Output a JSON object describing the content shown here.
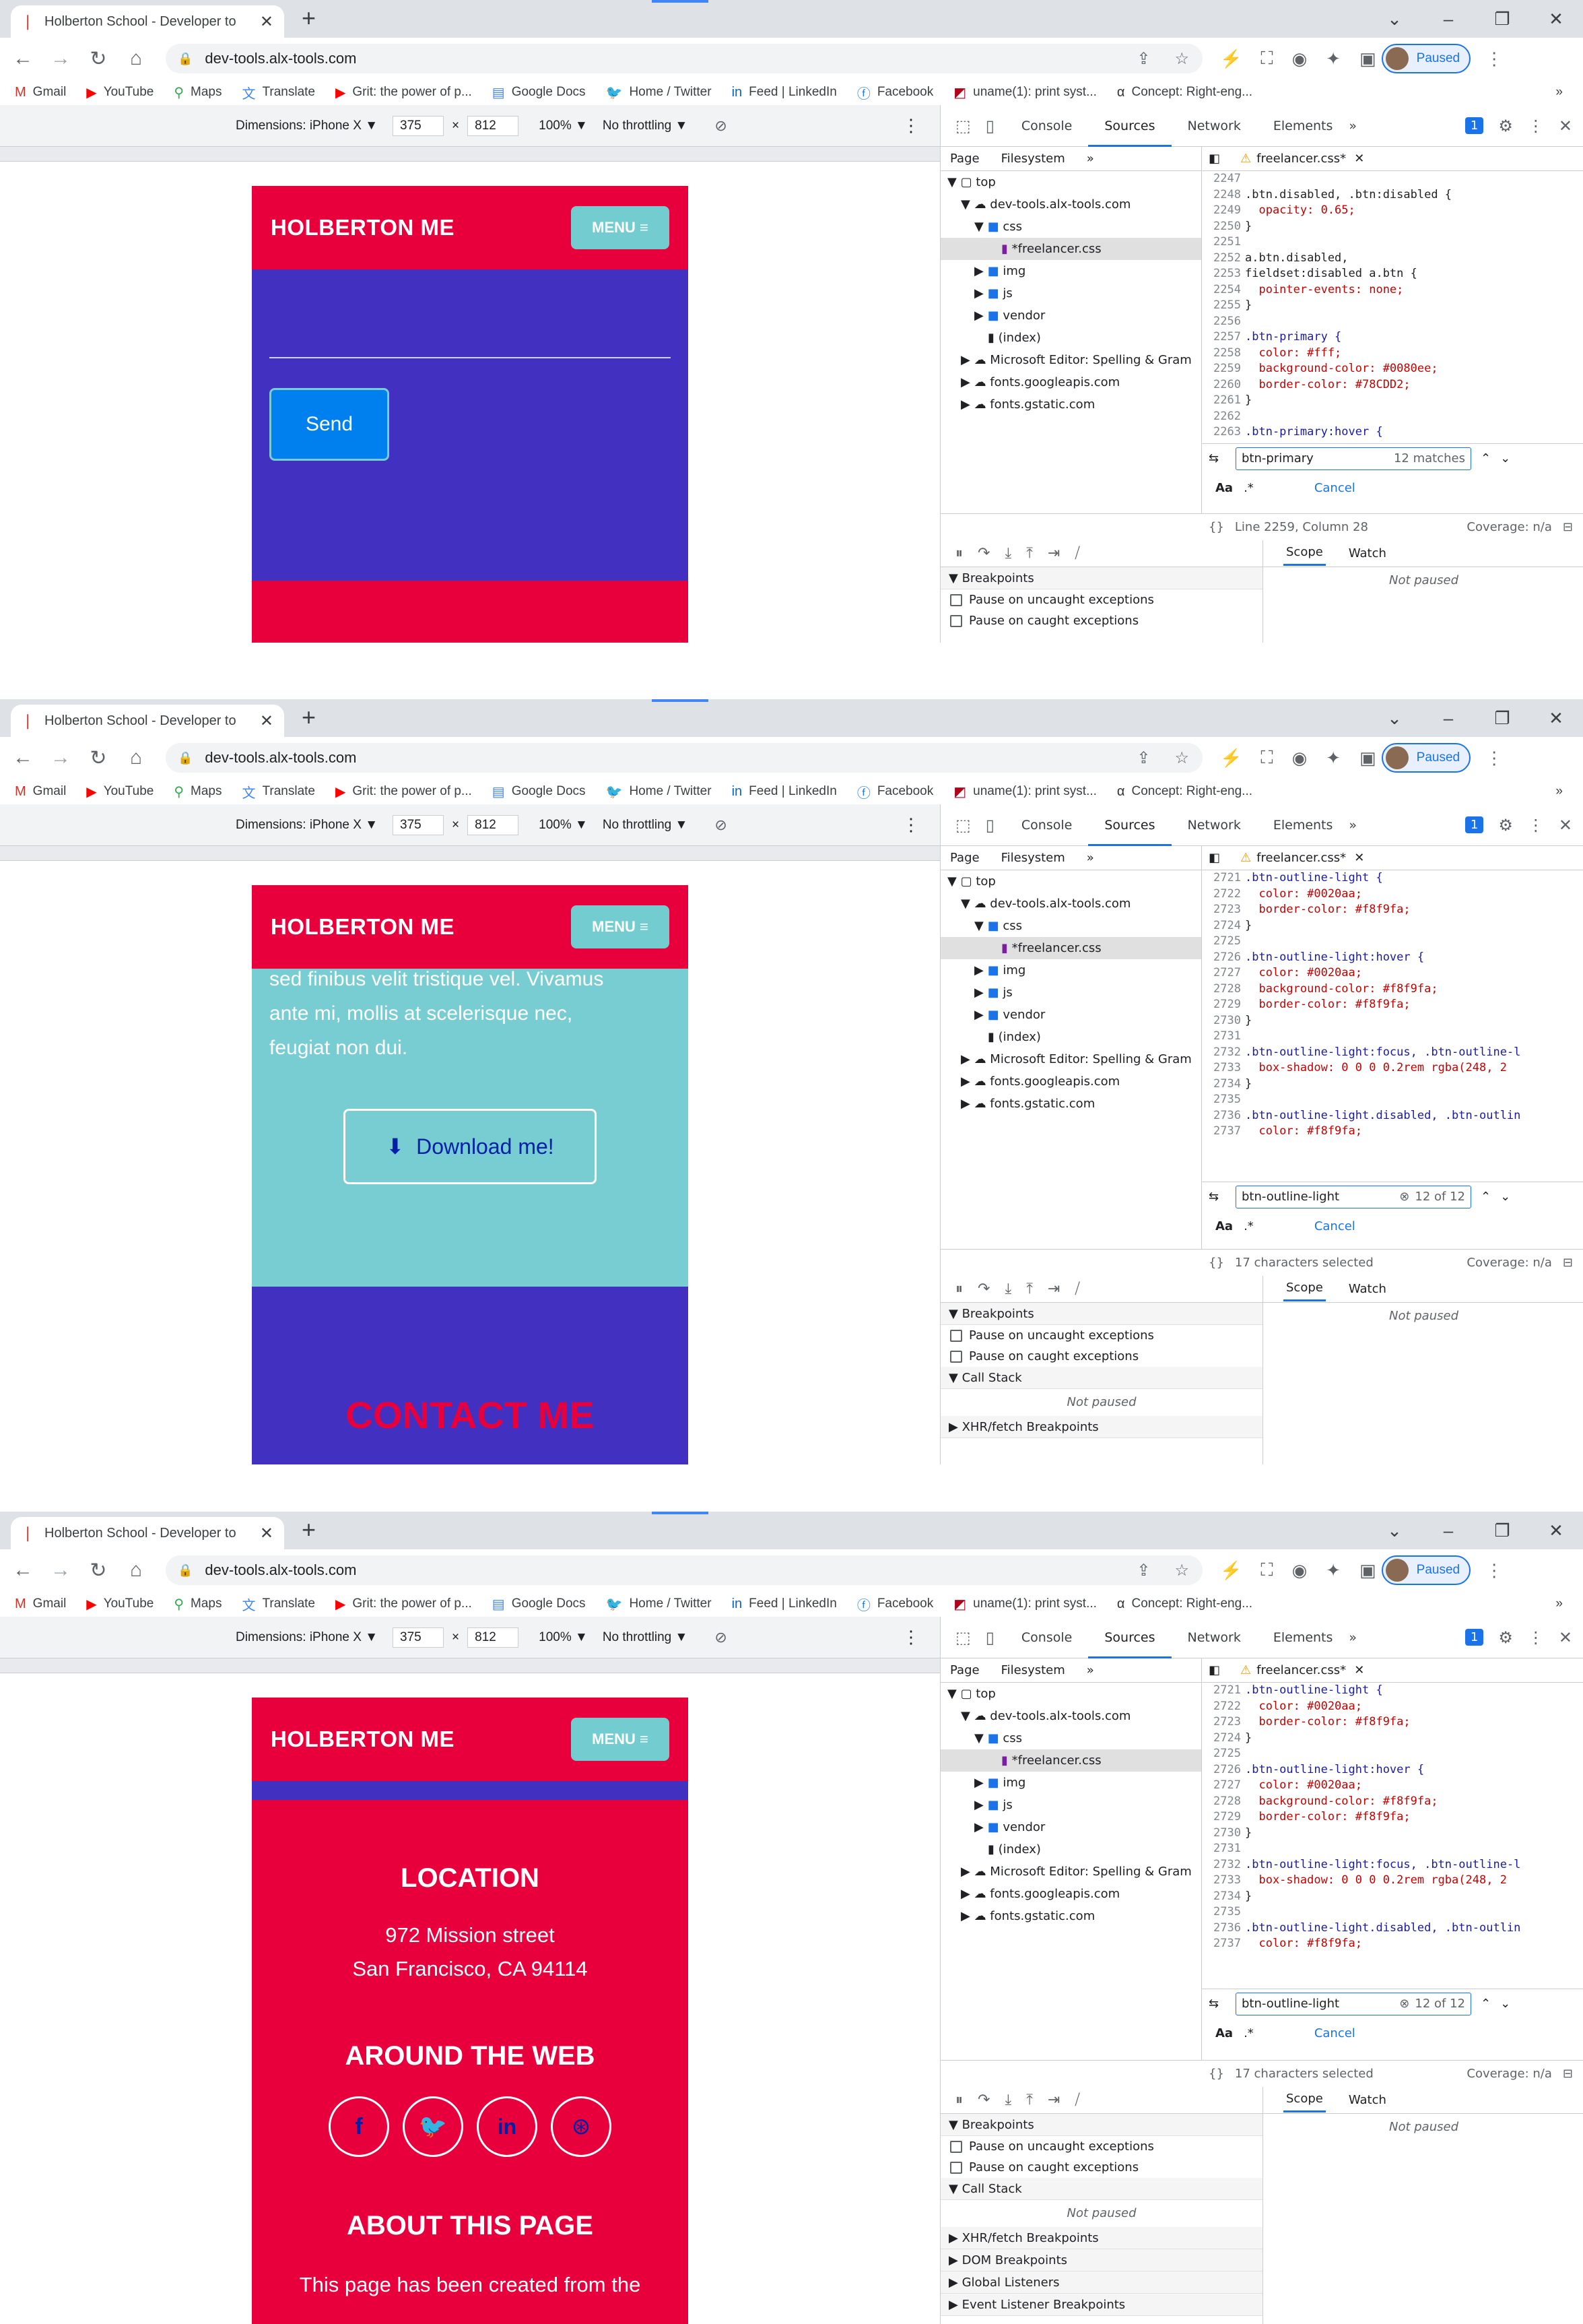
{
  "browser": {
    "tab_title": "Holberton School - Developer to",
    "url": "dev-tools.alx-tools.com",
    "profile_status": "Paused",
    "bookmarks": [
      "Gmail",
      "YouTube",
      "Maps",
      "Translate",
      "Grit: the power of p...",
      "Google Docs",
      "Home / Twitter",
      "Feed | LinkedIn",
      "Facebook",
      "uname(1): print syst...",
      "Concept: Right-eng..."
    ]
  },
  "device_toolbar": {
    "dimensions_label": "Dimensions: iPhone X ▼",
    "width": "375",
    "times": "×",
    "height": "812",
    "zoom": "100% ▼",
    "throttling": "No throttling ▼"
  },
  "devtools": {
    "tabs": [
      "Console",
      "Sources",
      "Network",
      "Elements"
    ],
    "issues_badge": "1",
    "page_tabs": [
      "Page",
      "Filesystem"
    ],
    "file_tab": "freelancer.css*",
    "tree": [
      "top",
      "dev-tools.alx-tools.com",
      "css",
      "*freelancer.css",
      "img",
      "js",
      "vendor",
      "(index)",
      "Microsoft Editor: Spelling & Gram",
      "fonts.googleapis.com",
      "fonts.gstatic.com"
    ],
    "cancel": "Cancel",
    "coverage": "Coverage: n/a",
    "scope": "Scope",
    "watch": "Watch",
    "not_paused": "Not paused",
    "breakpoints": "Breakpoints",
    "pause_uncaught": "Pause on uncaught exceptions",
    "pause_caught": "Pause on caught exceptions",
    "call_stack": "Call Stack",
    "xhr": "XHR/fetch Breakpoints",
    "dom": "DOM Breakpoints",
    "global": "Global Listeners",
    "event": "Event Listener Breakpoints"
  },
  "site": {
    "brand": "HOLBERTON ME",
    "menu": "MENU ≡",
    "send": "Send",
    "about_text_a": "sed finibus velit tristique vel. Vivamus",
    "about_text_b": "ante mi, mollis at scelerisque nec,",
    "about_text_c": "feugiat non dui.",
    "download": "Download me!",
    "contact": "CONTACT ME",
    "location_title": "LOCATION",
    "address_1": "972 Mission street",
    "address_2": "San Francisco, CA 94114",
    "web_title": "AROUND THE WEB",
    "about_page_title": "ABOUT THIS PAGE",
    "about_page_text": "This page has been created from the"
  },
  "shot1": {
    "search_query": "btn-primary",
    "match_count": "12 matches",
    "status": "Line 2259, Column 28",
    "code": [
      [
        "2247",
        ""
      ],
      [
        "2248",
        ".btn.disabled, .btn:disabled {"
      ],
      [
        "2249",
        "  opacity: 0.65;"
      ],
      [
        "2250",
        "}"
      ],
      [
        "2251",
        ""
      ],
      [
        "2252",
        "a.btn.disabled,"
      ],
      [
        "2253",
        "fieldset:disabled a.btn {"
      ],
      [
        "2254",
        "  pointer-events: none;"
      ],
      [
        "2255",
        "}"
      ],
      [
        "2256",
        ""
      ],
      [
        "2257",
        ".btn-primary {"
      ],
      [
        "2258",
        "  color: #fff;"
      ],
      [
        "2259",
        "  background-color: #0080ee;"
      ],
      [
        "2260",
        "  border-color: #78CDD2;"
      ],
      [
        "2261",
        "}"
      ],
      [
        "2262",
        ""
      ],
      [
        "2263",
        ".btn-primary:hover {"
      ]
    ]
  },
  "shot2": {
    "search_query": "btn-outline-light",
    "match_count": "12 of 12",
    "status": "17 characters selected",
    "code": [
      [
        "2721",
        ".btn-outline-light {"
      ],
      [
        "2722",
        "  color: #0020aa;"
      ],
      [
        "2723",
        "  border-color: #f8f9fa;"
      ],
      [
        "2724",
        "}"
      ],
      [
        "2725",
        ""
      ],
      [
        "2726",
        ".btn-outline-light:hover {"
      ],
      [
        "2727",
        "  color: #0020aa;"
      ],
      [
        "2728",
        "  background-color: #f8f9fa;"
      ],
      [
        "2729",
        "  border-color: #f8f9fa;"
      ],
      [
        "2730",
        "}"
      ],
      [
        "2731",
        ""
      ],
      [
        "2732",
        ".btn-outline-light:focus, .btn-outline-l"
      ],
      [
        "2733",
        "  box-shadow: 0 0 0 0.2rem rgba(248, 2"
      ],
      [
        "2734",
        "}"
      ],
      [
        "2735",
        ""
      ],
      [
        "2736",
        ".btn-outline-light.disabled, .btn-outlin"
      ],
      [
        "2737",
        "  color: #f8f9fa;"
      ]
    ]
  },
  "colors": {
    "red": "#e8003d",
    "purple": "#4231c0",
    "teal": "#78cdd2",
    "blue": "#0080ee",
    "accent": "#1a73e8"
  }
}
